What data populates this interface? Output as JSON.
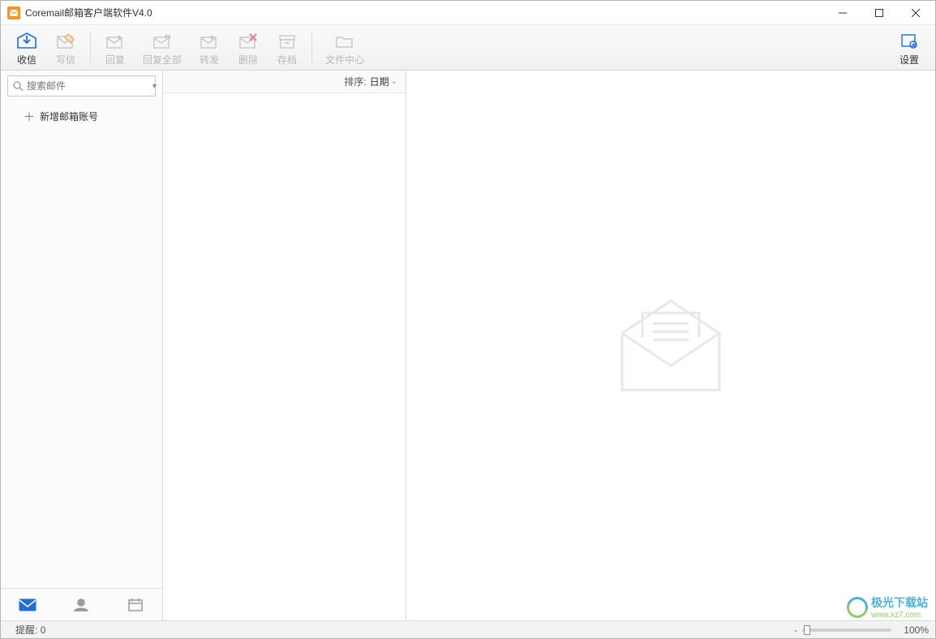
{
  "titlebar": {
    "title": "Coremail邮箱客户端软件V4.0"
  },
  "toolbar": {
    "receive": "收信",
    "compose": "写信",
    "reply": "回复",
    "reply_all": "回复全部",
    "forward": "转发",
    "delete": "删除",
    "archive": "存档",
    "file_center": "文件中心",
    "settings": "设置"
  },
  "sidebar": {
    "search_placeholder": "搜索邮件",
    "add_account": "新增邮箱账号"
  },
  "listcol": {
    "sort_label": "排序:",
    "sort_value": "日期"
  },
  "statusbar": {
    "reminder_label": "提醒:",
    "reminder_count": "0",
    "zoom_minus": "-",
    "zoom_value": "100%"
  },
  "watermark": {
    "text": "极光下载站",
    "url": "www.xz7.com"
  }
}
